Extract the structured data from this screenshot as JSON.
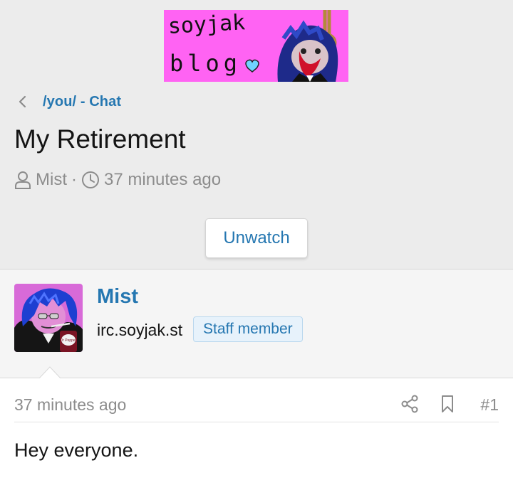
{
  "logo": {
    "line1": "soyjak",
    "line2": "blog"
  },
  "breadcrumb": {
    "forum_label": "/you/ - Chat"
  },
  "thread": {
    "title": "My Retirement",
    "author": "Mist",
    "separator": "·",
    "time": "37 minutes ago"
  },
  "actions": {
    "unwatch_label": "Unwatch"
  },
  "user": {
    "name": "Mist",
    "title": "irc.soyjak.st",
    "badge": "Staff member",
    "avatar_can_text": "Dr Pepper"
  },
  "post": {
    "time": "37 minutes ago",
    "number": "#1",
    "body": "Hey everyone."
  },
  "colors": {
    "link": "#2577b1",
    "muted": "#8c8c8c",
    "header_bg": "#ececec",
    "user_block_bg": "#f5f5f5",
    "badge_bg": "#e7f2fb",
    "logo_bg": "#ff63f3"
  },
  "icons": {
    "back": "chevron-left-icon",
    "author": "user-icon",
    "time": "clock-icon",
    "share": "share-icon",
    "bookmark": "bookmark-icon"
  }
}
